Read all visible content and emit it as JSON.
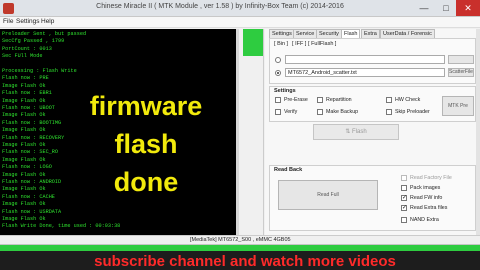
{
  "window": {
    "title": "Chinese Miracle II ( MTK Module , ver 1.58 ) by Infinity-Box Team (c) 2014-2016",
    "minimize": "—",
    "maximize": "□",
    "close": "✕"
  },
  "menu": [
    "File",
    "Settings",
    "Help"
  ],
  "log_lines": [
    "Preloader Sent , but passed",
    "SecCfg Passed , 1799",
    "PortCount : 0013",
    "Sec FUll Mode",
    "",
    "Processing : Flash Write",
    "Flash now : PRE",
    "Image Flash Ok",
    "Flash now : EBR1",
    "Image Flash Ok",
    "Flash now : UBOOT",
    "Image Flash Ok",
    "Flash now : BOOTIMG",
    "Image Flash Ok",
    "Flash now : RECOVERY",
    "Image Flash Ok",
    "Flash now : SEC_RO",
    "Image Flash Ok",
    "Flash now : LOGO",
    "Image Flash Ok",
    "Flash now : ANDROID",
    "Image Flash Ok",
    "Flash now : CACHE",
    "Image Flash Ok",
    "Flash now : USRDATA",
    "Image Flash Ok",
    "Flash Write Done, time used : 00:03:38"
  ],
  "overlay": [
    "firmware",
    "flash",
    "done"
  ],
  "tabs": [
    "Settings",
    "Service",
    "Security",
    "Flash",
    "Extra",
    "UserData / Forensic"
  ],
  "active_tab": "Flash",
  "bin_section": {
    "title": "Bin",
    "subtabs": [
      "Bin",
      "IFF",
      "FullFlash"
    ],
    "scatter_file": "MT6572_Android_scatter.txt",
    "scatter_button": "ScatterFile"
  },
  "settings": {
    "title": "Settings",
    "options": [
      {
        "label": "Pre-Erase",
        "checked": false
      },
      {
        "label": "Repartition",
        "checked": false
      },
      {
        "label": "HW Check",
        "checked": false
      },
      {
        "label": "Verify",
        "checked": false
      },
      {
        "label": "Make Backup",
        "checked": false
      },
      {
        "label": "Skip Preloader",
        "checked": false
      }
    ],
    "side_button": "MTK Pre",
    "flash_button": "Flash"
  },
  "readback": {
    "title": "Read Back",
    "read_full_button": "Read Full",
    "options": [
      {
        "label": "Read Factory File",
        "checked": false,
        "disabled": true
      },
      {
        "label": "Pack images",
        "checked": false,
        "disabled": false
      },
      {
        "label": "Read FW info",
        "checked": true,
        "disabled": false
      },
      {
        "label": "Read Extra files",
        "checked": true,
        "disabled": false
      },
      {
        "label": "NAND Extra",
        "checked": false,
        "disabled": false
      }
    ]
  },
  "status": {
    "text": "[MediaTek] MT6572_S00 , eMMC 4GB05"
  },
  "progress": 1.0,
  "banner": "subscribe channel and watch more videos",
  "colors": {
    "log_bg": "#000000",
    "log_text": "#2ee02e",
    "overlay_text": "#f2ea0c",
    "progress_fill": "#2ecc40",
    "banner_text": "#ff2a2a",
    "close_button": "#c9302c"
  }
}
